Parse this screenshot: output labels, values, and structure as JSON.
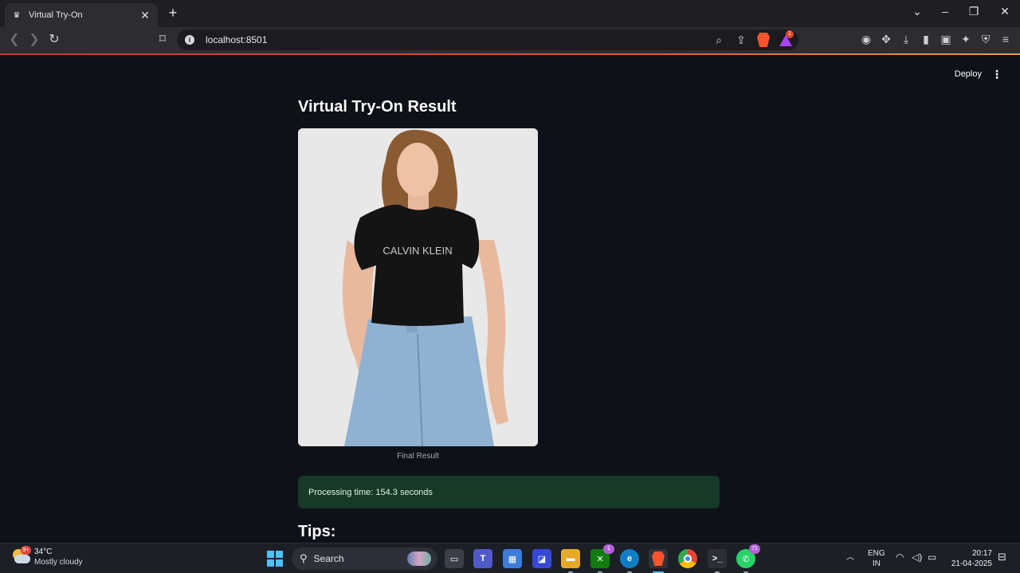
{
  "browser": {
    "tab_title": "Virtual Try-On",
    "url": "localhost:8501",
    "rewards_count": "1"
  },
  "app": {
    "deploy_label": "Deploy",
    "title": "Virtual Try-On Result",
    "image_caption": "Final Result",
    "image_shirt_text": "CALVIN KLEIN",
    "processing_message": "Processing time: 154.3 seconds",
    "tips_heading": "Tips:"
  },
  "taskbar": {
    "weather_temp": "34°C",
    "weather_desc": "Mostly cloudy",
    "weather_badge": "9+",
    "search_placeholder": "Search",
    "xbox_badge": "1",
    "whatsapp_badge": "71",
    "lang": "ENG",
    "region": "IN",
    "time": "20:17",
    "date": "21-04-2025"
  },
  "colors": {
    "page_bg": "#0e1117",
    "success_bg": "#173928",
    "accent": "#4cc2ff"
  }
}
